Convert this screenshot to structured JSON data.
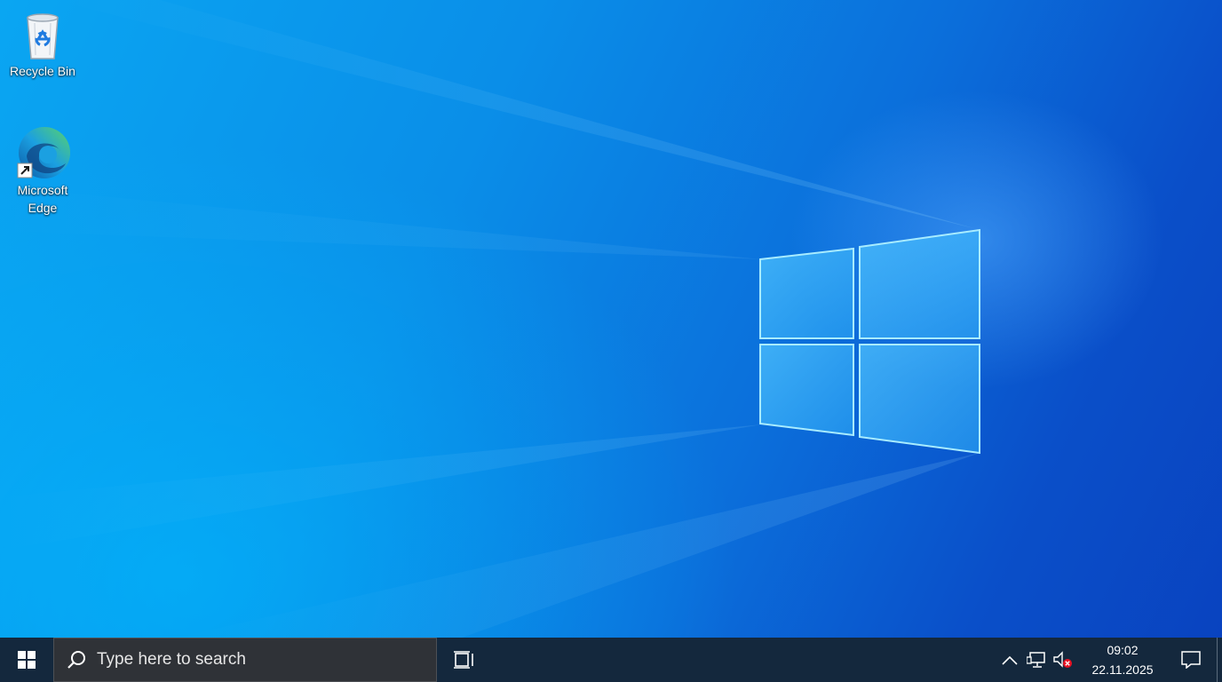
{
  "desktop": {
    "icons": [
      {
        "label": "Recycle Bin",
        "icon": "recycle-bin-icon"
      },
      {
        "label": "Microsoft Edge",
        "icon": "edge-icon"
      }
    ],
    "wallpaper": "windows-10-hero-wallpaper"
  },
  "taskbar": {
    "start_icon": "windows-logo-icon",
    "search": {
      "placeholder": "Type here to search",
      "icon": "search-icon"
    },
    "task_view_icon": "task-view-icon",
    "tray": {
      "show_hidden_icon": "chevron-up-icon",
      "network_icon": "network-icon",
      "volume_icon": "volume-muted-icon",
      "time": "09:02",
      "date": "22.11.2025",
      "notifications_icon": "action-center-icon"
    }
  },
  "colors": {
    "taskbar_bg": "#14283d",
    "search_bg": "#2f3237",
    "wallpaper_primary": "#0a8ee8"
  }
}
